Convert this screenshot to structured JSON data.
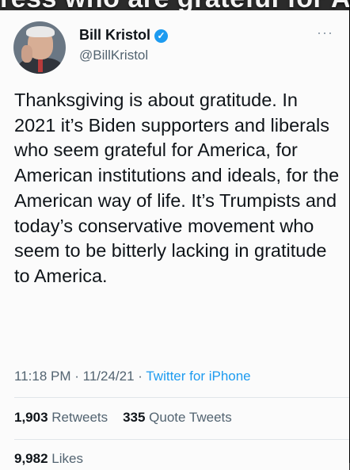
{
  "caption": {
    "text": "ress who are grateful for Am"
  },
  "tweet": {
    "author_name": "Bill Kristol",
    "verified_glyph": "✓",
    "handle": "@BillKristol",
    "more_glyph": "···",
    "text": "Thanksgiving is about gratitude. In 2021 it’s Biden supporters and liberals who seem grateful for America, for American institutions and ideals, for the American way of life. It’s Trumpists and today’s conservative movement who seem to be bitterly lacking in gratitude to America.",
    "time": "11:18 PM",
    "sep1": " · ",
    "date": "11/24/21",
    "sep2": " · ",
    "source": "Twitter for iPhone"
  },
  "stats": {
    "retweets_count": "1,903",
    "retweets_label": "Retweets",
    "quote_count": "335",
    "quote_label": "Quote Tweets",
    "likes_count": "9,982",
    "likes_label": "Likes"
  },
  "colors": {
    "accent": "#1d9bf0",
    "text": "#0f1419",
    "secondary": "#536471"
  },
  "icons": {
    "verified": "verified-badge-icon",
    "more": "more-options-icon"
  }
}
